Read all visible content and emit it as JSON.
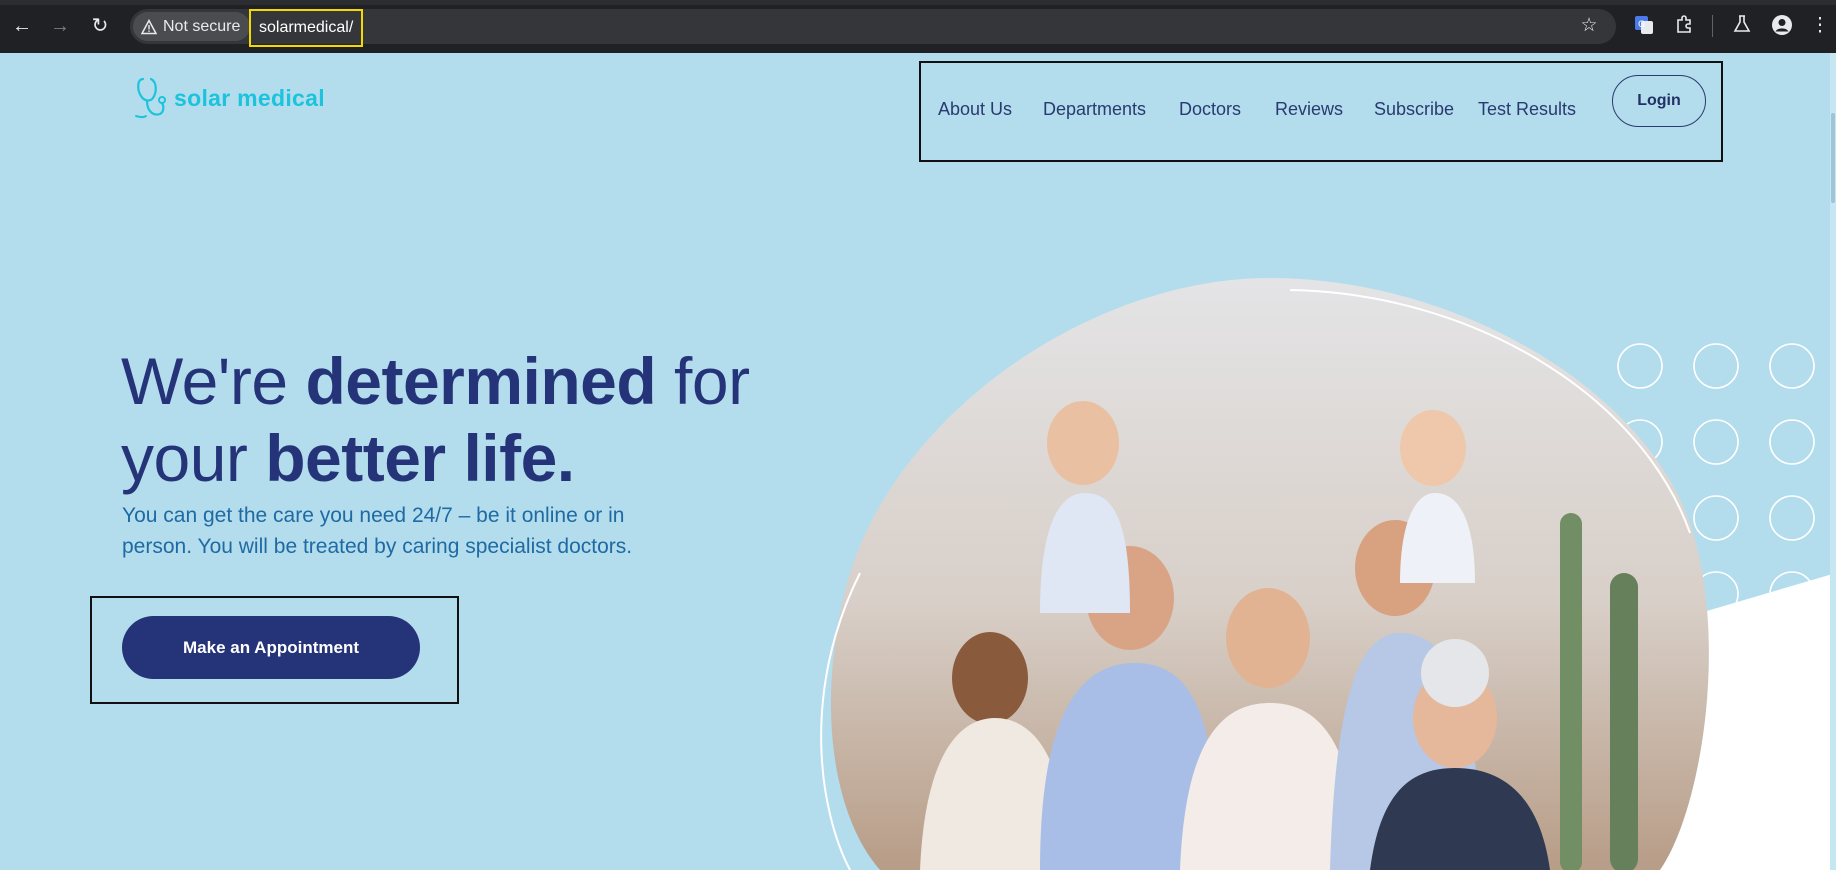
{
  "browser": {
    "security_label": "Not secure",
    "url": "solarmedical/"
  },
  "site": {
    "brand": "solar medical",
    "nav": [
      {
        "label": "About Us"
      },
      {
        "label": "Departments"
      },
      {
        "label": "Doctors"
      },
      {
        "label": "Reviews"
      },
      {
        "label": "Subscribe"
      },
      {
        "label": "Test Results"
      }
    ],
    "login_label": "Login",
    "hero": {
      "title_plain_1": "We're ",
      "title_bold_1": "determined",
      "title_plain_2": " for your ",
      "title_bold_2": "better life.",
      "subtitle": "You can get the care you need 24/7 – be it online or in person. You will be treated by caring specialist doctors.",
      "cta_label": "Make an Appointment"
    }
  },
  "colors": {
    "page_bg": "#b3ddec",
    "brand": "#1bc4dc",
    "navy": "#253479",
    "subtitle": "#1f6aa3"
  }
}
